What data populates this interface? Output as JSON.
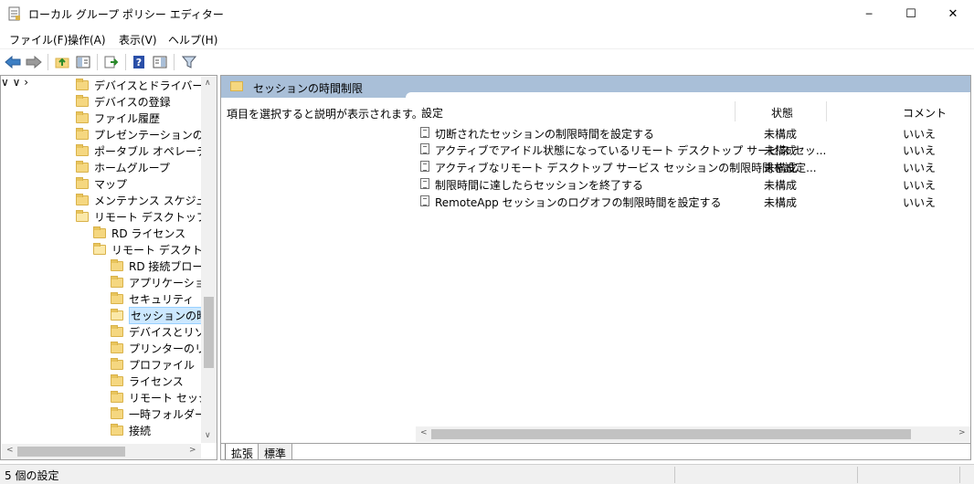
{
  "window": {
    "title": "ローカル グループ ポリシー エディター",
    "minimize_glyph": "─",
    "maximize_glyph": "☐",
    "close_glyph": "✕"
  },
  "menu": [
    {
      "label": "ファイル(F)"
    },
    {
      "label": "操作(A)"
    },
    {
      "label": "表示(V)"
    },
    {
      "label": "ヘルプ(H)"
    }
  ],
  "toolbar": {
    "icons": [
      "back-icon",
      "forward-icon",
      "up-folder-icon",
      "show-hide-tree-icon",
      "export-list-icon",
      "help-icon",
      "show-hide-action-pane-icon",
      "filter-icon"
    ]
  },
  "tree": {
    "items": [
      {
        "label": "デバイスとドライバーの互換"
      },
      {
        "label": "デバイスの登録"
      },
      {
        "label": "ファイル履歴"
      },
      {
        "label": "プレゼンテーションの設定"
      },
      {
        "label": "ポータブル オペレーティング"
      },
      {
        "label": "ホームグループ"
      },
      {
        "label": "マップ"
      },
      {
        "label": "メンテナンス スケジューラ"
      },
      {
        "label": "リモート デスクトップ サービス"
      },
      {
        "label": "RD ライセンス"
      },
      {
        "label": "リモート デスクトップ セッション"
      },
      {
        "label": "RD 接続ブローカー"
      },
      {
        "label": "アプリケーションの"
      },
      {
        "label": "セキュリティ"
      },
      {
        "label": "セッションの時間制限"
      },
      {
        "label": "デバイスとリソース"
      },
      {
        "label": "プリンターのリダイ"
      },
      {
        "label": "プロファイル"
      },
      {
        "label": "ライセンス"
      },
      {
        "label": "リモート セッション"
      },
      {
        "label": "一時フォルダー"
      },
      {
        "label": "接続"
      }
    ]
  },
  "details": {
    "header_title": "セッションの時間制限",
    "description": "項目を選択すると説明が表示されます。",
    "columns": {
      "setting": "設定",
      "state": "状態",
      "comment": "コメント"
    },
    "rows": [
      {
        "name": "切断されたセッションの制限時間を設定する",
        "state": "未構成",
        "comment": "いいえ"
      },
      {
        "name": "アクティブでアイドル状態になっているリモート デスクトップ サービス セッ...",
        "state": "未構成",
        "comment": "いいえ"
      },
      {
        "name": "アクティブなリモート デスクトップ サービス セッションの制限時間を設定...",
        "state": "未構成",
        "comment": "いいえ"
      },
      {
        "name": "制限時間に達したらセッションを終了する",
        "state": "未構成",
        "comment": "いいえ"
      },
      {
        "name": "RemoteApp セッションのログオフの制限時間を設定する",
        "state": "未構成",
        "comment": "いいえ"
      }
    ]
  },
  "tabs": {
    "extended": "拡張",
    "standard": "標準"
  },
  "status": {
    "text": "5 個の設定"
  },
  "colors": {
    "header_band": "#a9bfd8",
    "selection": "#cce8ff"
  }
}
